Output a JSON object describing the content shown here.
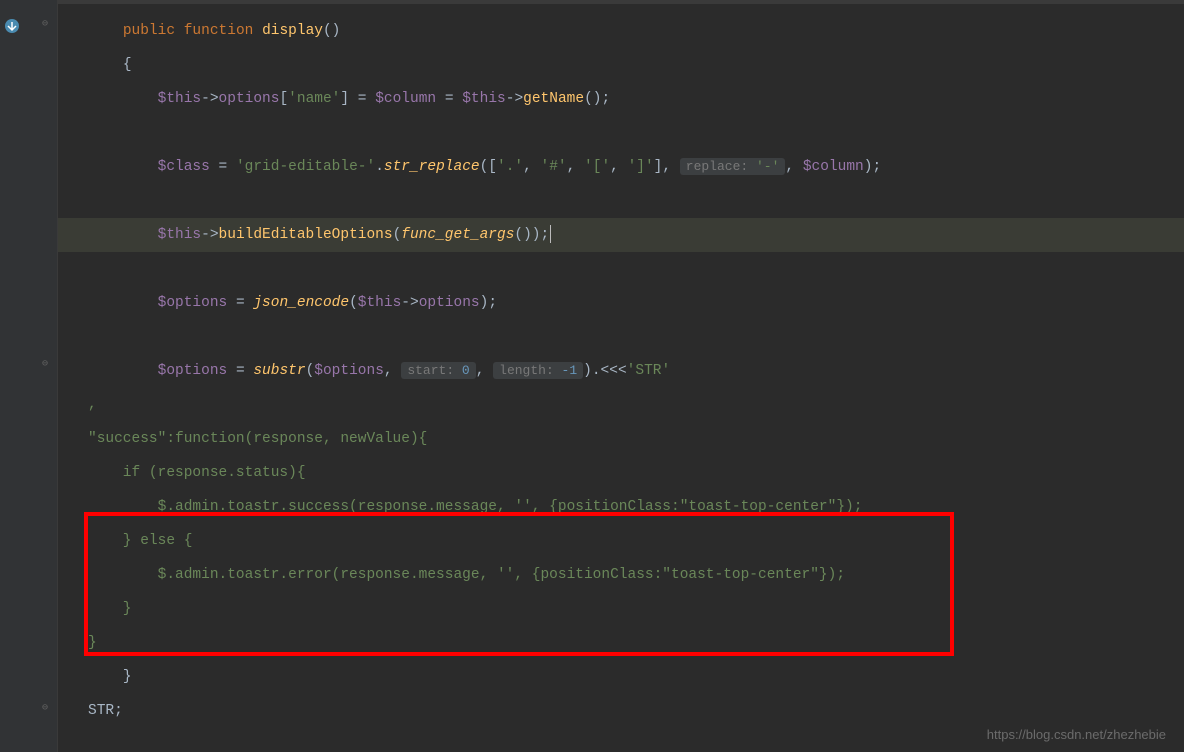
{
  "code": {
    "line1_public": "public",
    "line1_function": "function",
    "line1_name": "display",
    "line1_parens": "()",
    "line2_brace": "{",
    "line3_this": "$this",
    "line3_arrow": "->",
    "line3_options": "options",
    "line3_bracket": "[",
    "line3_key": "'name'",
    "line3_bracket2": "] = ",
    "line3_column": "$column",
    "line3_eq": " = ",
    "line3_this2": "$this",
    "line3_arrow2": "->",
    "line3_getName": "getName",
    "line3_end": "();",
    "line5_class": "$class",
    "line5_eq": " = ",
    "line5_str1": "'grid-editable-'",
    "line5_dot": ".",
    "line5_strreplace": "str_replace",
    "line5_args1": "([",
    "line5_s1": "'.'",
    "line5_c1": ", ",
    "line5_s2": "'#'",
    "line5_c2": ", ",
    "line5_s3": "'['",
    "line5_c3": ", ",
    "line5_s4": "']'",
    "line5_args2": "], ",
    "line5_hint": "replace:",
    "line5_hintval": " '-'",
    "line5_c4": ", ",
    "line5_column2": "$column",
    "line5_end": ");",
    "line7_this": "$this",
    "line7_arrow": "->",
    "line7_build": "buildEditableOptions",
    "line7_paren": "(",
    "line7_func": "func_get_args",
    "line7_end": "());",
    "line9_options": "$options",
    "line9_eq": " = ",
    "line9_json": "json_encode",
    "line9_paren": "(",
    "line9_this": "$this",
    "line9_arrow": "->",
    "line9_opt": "options",
    "line9_end": ");",
    "line11_options": "$options",
    "line11_eq": " = ",
    "line11_substr": "substr",
    "line11_paren": "(",
    "line11_opt2": "$options",
    "line11_c": ", ",
    "line11_hint1": "start:",
    "line11_hint1v": " 0",
    "line11_c2": ", ",
    "line11_hint2": "length:",
    "line11_hint2v": " -1",
    "line11_end": ").<<<",
    "line11_str": "'STR'",
    "line12_comma": ",",
    "line13_content": "\"success\":function(response, newValue){",
    "line14_content": "    if (response.status){",
    "line15_content": "        $.admin.toastr.success(response.message, '', {positionClass:\"toast-top-center\"});",
    "line16_content": "    } else {",
    "line17_content": "        $.admin.toastr.error(response.message, '', {positionClass:\"toast-top-center\"});",
    "line18_content": "    }",
    "line19_content": "}",
    "line20_brace": "}",
    "line21_str": "STR;"
  },
  "watermark": "https://blog.csdn.net/zhezhebie",
  "colors": {
    "accent_red": "#ff0000",
    "bg": "#2b2b2b"
  }
}
